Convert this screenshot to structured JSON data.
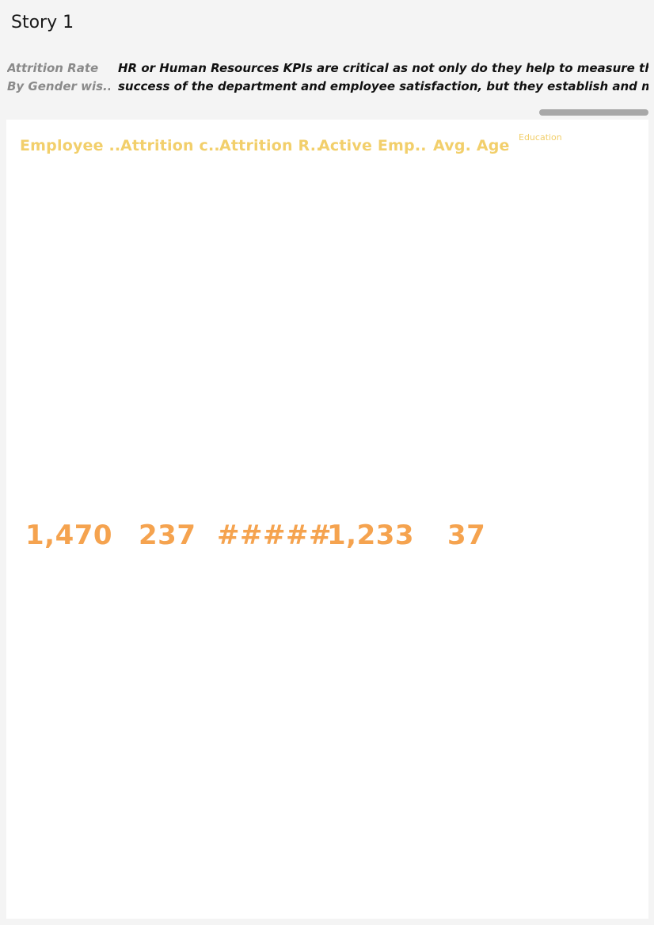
{
  "story": {
    "title": "Story 1"
  },
  "navigator": {
    "points": [
      {
        "line1": "Attrition Rate",
        "line2": "By Gender wis.."
      },
      {
        "line1": "HR or Human Resources KPIs are critical as not only do they help to measure the",
        "line2": "success of the department and employee satisfaction, but they establish and maintain .."
      }
    ]
  },
  "dashboard": {
    "kpis": [
      {
        "header": "Employee ..",
        "value": "1,470"
      },
      {
        "header": "Attrition c..",
        "value": "237"
      },
      {
        "header": "Attrition R..",
        "value": "#####"
      },
      {
        "header": "Active Emp..",
        "value": "1,233"
      },
      {
        "header": "Avg. Age",
        "value": "37"
      }
    ],
    "education_label": "Education"
  },
  "colors": {
    "header": "#f2cf6b",
    "value": "#f5a34f",
    "background": "#f4f4f4"
  }
}
